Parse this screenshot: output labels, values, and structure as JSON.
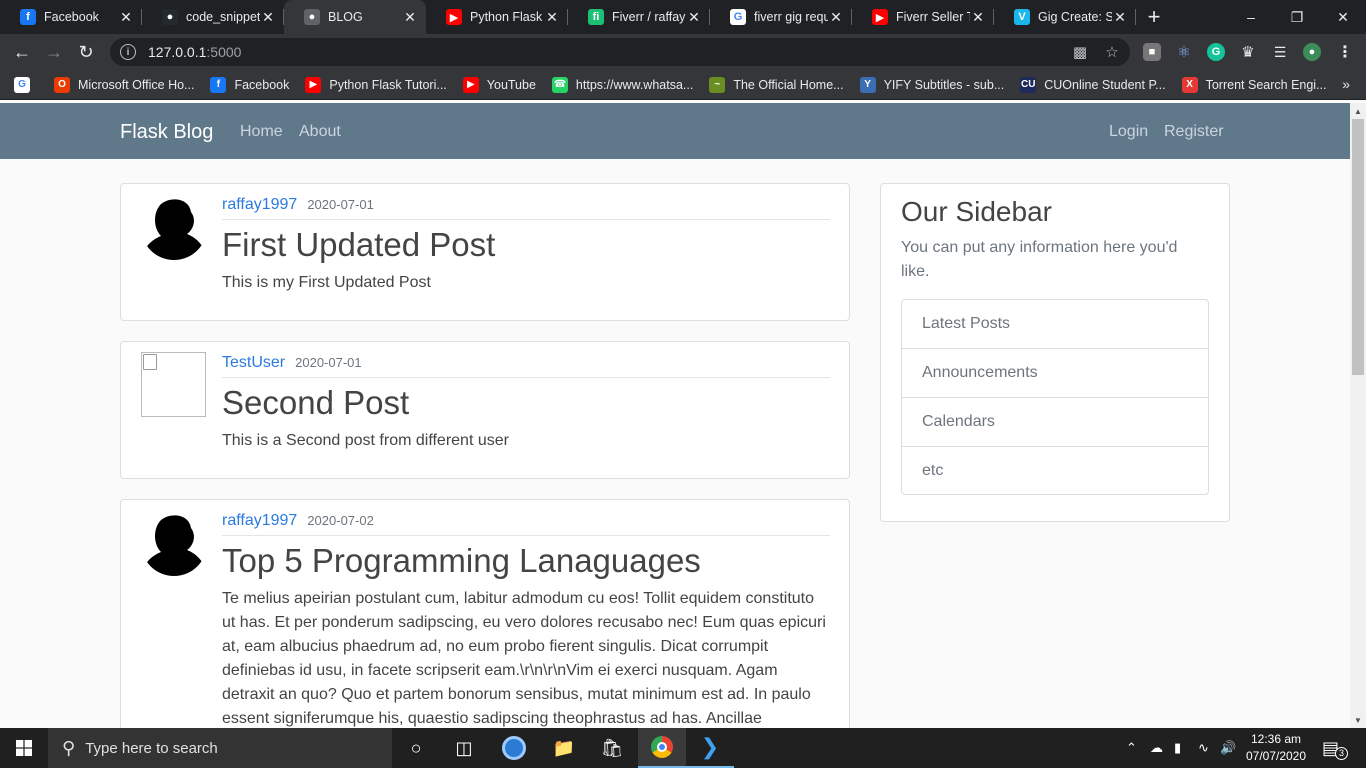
{
  "browser": {
    "tabs": [
      {
        "title": "Facebook",
        "icon": "facebook-icon",
        "color": "#1877f2",
        "glyph": "f",
        "active": false
      },
      {
        "title": "code_snippets",
        "icon": "github-icon",
        "color": "#24292e",
        "glyph": "●",
        "active": false
      },
      {
        "title": "BLOG",
        "icon": "globe-icon",
        "color": "#5f6368",
        "glyph": "●",
        "active": true
      },
      {
        "title": "Python Flask Tu",
        "icon": "youtube-icon",
        "color": "#ff0000",
        "glyph": "▶",
        "active": false
      },
      {
        "title": "Fiverr / raffayh",
        "icon": "fiverr-icon",
        "color": "#1dbf73",
        "glyph": "fi",
        "active": false
      },
      {
        "title": "fiverr gig requ",
        "icon": "google-icon",
        "color": "#ffffff",
        "glyph": "G",
        "active": false
      },
      {
        "title": "Fiverr Seller Tip",
        "icon": "youtube-icon",
        "color": "#ff0000",
        "glyph": "▶",
        "active": false
      },
      {
        "title": "Gig Create: Ste",
        "icon": "vimeo-icon",
        "color": "#1ab7ea",
        "glyph": "V",
        "active": false
      }
    ],
    "url_host": "127.0.0.1",
    "url_port": ":5000",
    "bookmarks": [
      {
        "title": "",
        "icon": "google-icon",
        "color": "#ffffff",
        "glyph": "G"
      },
      {
        "title": "Microsoft Office Ho...",
        "icon": "office-icon",
        "color": "#eb3c00",
        "glyph": "O"
      },
      {
        "title": "Facebook",
        "icon": "facebook-icon",
        "color": "#1877f2",
        "glyph": "f"
      },
      {
        "title": "Python Flask Tutori...",
        "icon": "youtube-icon",
        "color": "#ff0000",
        "glyph": "▶"
      },
      {
        "title": "YouTube",
        "icon": "youtube-icon",
        "color": "#ff0000",
        "glyph": "▶"
      },
      {
        "title": "https://www.whatsa...",
        "icon": "whatsapp-icon",
        "color": "#25d366",
        "glyph": "☎"
      },
      {
        "title": "The Official Home...",
        "icon": "site-icon",
        "color": "#6b8e23",
        "glyph": "~"
      },
      {
        "title": "YIFY Subtitles - sub...",
        "icon": "yify-icon",
        "color": "#3b6db3",
        "glyph": "Y"
      },
      {
        "title": "CUOnline Student P...",
        "icon": "cuonline-icon",
        "color": "#1e2a5a",
        "glyph": "CU"
      },
      {
        "title": "Torrent Search Engi...",
        "icon": "torrent-icon",
        "color": "#e53935",
        "glyph": "X"
      }
    ],
    "bookmarks_more": "»"
  },
  "site": {
    "brand": "Flask Blog",
    "nav_left": [
      "Home",
      "About"
    ],
    "nav_right": [
      "Login",
      "Register"
    ]
  },
  "posts": [
    {
      "author": "raffay1997",
      "date": "2020-07-01",
      "title": "First Updated Post",
      "body": "This is my First Updated Post",
      "avatar": "silhouette"
    },
    {
      "author": "TestUser",
      "date": "2020-07-01",
      "title": "Second Post",
      "body": "This is a Second post from different user",
      "avatar": "broken"
    },
    {
      "author": "raffay1997",
      "date": "2020-07-02",
      "title": "Top 5 Programming Lanaguages",
      "body_lines": [
        "Te melius apeirian postulant cum, labitur admodum cu eos! Tollit equidem constituto",
        "ut has. Et per ponderum sadipscing, eu vero dolores recusabo nec! Eum quas epicuri",
        "at, eam albucius phaedrum ad, no eum probo fierent singulis. Dicat corrumpit",
        "definiebas id usu, in facete scripserit eam.\\r\\n\\r\\nVim ei exerci nusquam. Agam",
        "detraxit an quo? Quo et partem bonorum sensibus, mutat minimum est ad. In paulo",
        "essent signiferumque his, quaestio sadipscing theophrastus ad has. Ancillae appareat"
      ],
      "avatar": "silhouette"
    }
  ],
  "sidebar": {
    "title": "Our Sidebar",
    "text": "You can put any information here you'd like.",
    "items": [
      "Latest Posts",
      "Announcements",
      "Calendars",
      "etc"
    ]
  },
  "taskbar": {
    "search_placeholder": "Type here to search",
    "time": "12:36 am",
    "date": "07/07/2020",
    "notifications": "3"
  }
}
